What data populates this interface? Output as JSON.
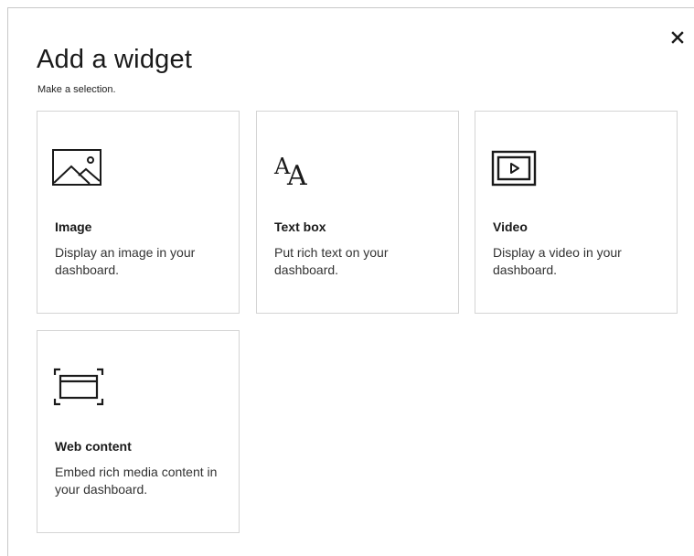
{
  "dialog": {
    "title": "Add a widget",
    "subtitle": "Make a selection.",
    "close_label": "×"
  },
  "widgets": [
    {
      "title": "Image",
      "description": "Display an image in your dashboard.",
      "icon": "image-icon"
    },
    {
      "title": "Text box",
      "description": "Put rich text on your dashboard.",
      "icon": "text-box-icon"
    },
    {
      "title": "Video",
      "description": "Display a video in your dashboard.",
      "icon": "video-icon"
    },
    {
      "title": "Web content",
      "description": "Embed rich media content in your dashboard.",
      "icon": "web-content-icon"
    }
  ]
}
